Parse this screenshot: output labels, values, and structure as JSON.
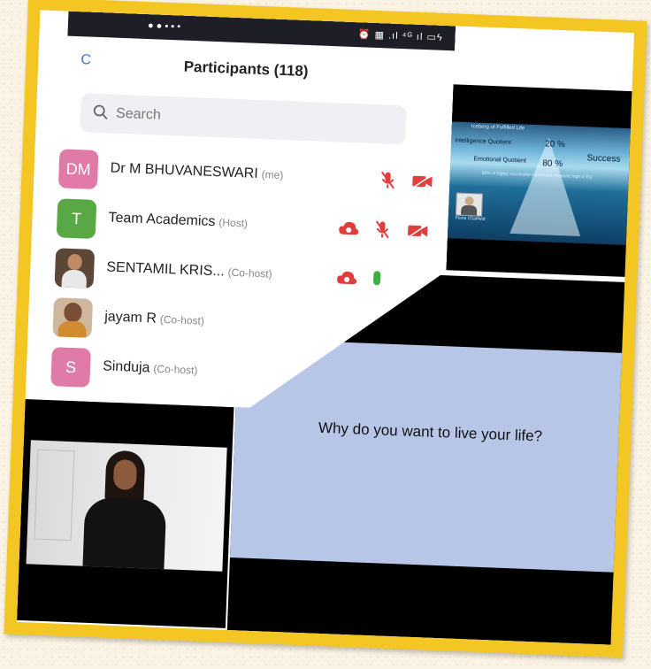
{
  "status_bar": {
    "left_icons": "● ● ▪ ▪ •",
    "right_icons": "⏰ ▦ .ıl ⁴ᴳ ıl ▭ϟ"
  },
  "panel": {
    "close_label": "C",
    "title": "Participants (118)",
    "search_placeholder": "Search"
  },
  "participants": [
    {
      "initials": "DM",
      "name": "Dr M BHUVANESWARI",
      "role": "(me)",
      "avatar_color": "#e07aa8"
    },
    {
      "initials": "T",
      "name": "Team Academics",
      "role": "(Host)",
      "avatar_color": "#5aa845"
    },
    {
      "initials": "",
      "name": "SENTAMIL KRIS...",
      "role": "(Co-host)",
      "avatar_color": "#5b4638"
    },
    {
      "initials": "",
      "name": "jayam R",
      "role": "(Co-host)",
      "avatar_color": "#8a6a55"
    },
    {
      "initials": "S",
      "name": "Sinduja",
      "role": "(Co-host)",
      "avatar_color": "#e07aa8"
    }
  ],
  "slide_top": {
    "title": "Iceberg of Fulfilled Life",
    "line1_label": "Intelligence Quotient",
    "line1_value": "20 %",
    "line1_right": "Success",
    "line2_label": "Emotional Quotient",
    "line2_value": "80 %",
    "footnote": "85% of highly successful individuals measure high in EQ",
    "speaker_caption": "Fiona Chatfield"
  },
  "slide_main": {
    "question": "Why do you want to live your life?"
  },
  "colors": {
    "frame": "#f3c624",
    "icon_red": "#e23d3d",
    "search_bg": "#eff0f3"
  }
}
